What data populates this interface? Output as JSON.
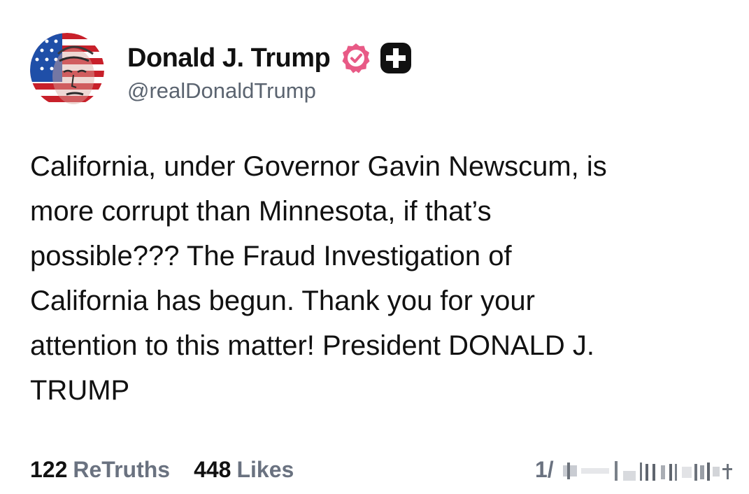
{
  "post": {
    "author": {
      "display_name": "Donald J. Trump",
      "handle": "@realDonaldTrump",
      "avatar_icon": "avatar-image",
      "verified_icon": "verified-badge-icon",
      "plus_icon": "plus-badge-icon"
    },
    "text": "California, under Governor Gavin Newscum, is\nmore corrupt than Minnesota, if that’s\npossible??? The Fraud Investigation of\nCalifornia has begun. Thank you for your\nattention to this matter! President DONALD J.\nTRUMP",
    "stats": {
      "retruths_count": "122",
      "retruths_label": "ReTruths",
      "likes_count": "448",
      "likes_label": "Likes"
    },
    "pager": "1/"
  },
  "colors": {
    "verified_pink": "#e85a86",
    "text": "#111111",
    "muted": "#6a7280",
    "handle": "#5b6470"
  }
}
